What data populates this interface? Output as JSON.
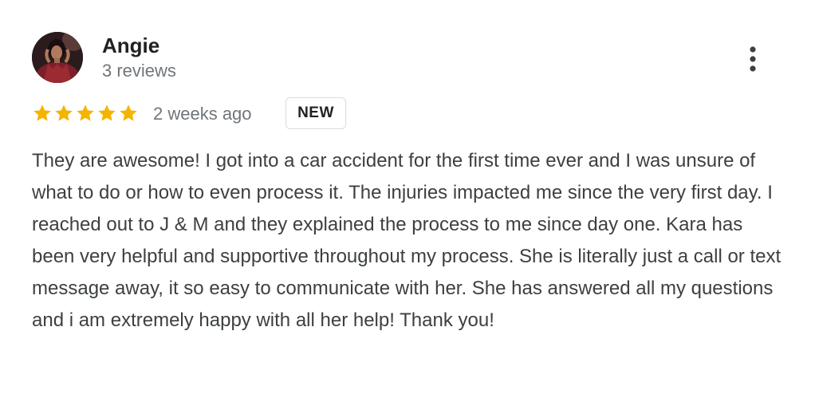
{
  "review": {
    "author": {
      "name": "Angie",
      "reviews_count": "3 reviews",
      "avatar_icon": "profile-photo-icon"
    },
    "rating": {
      "stars": 5,
      "max": 5,
      "color": "#f4b400"
    },
    "date": "2 weeks ago",
    "badge": "NEW",
    "text": "They are awesome! I got into a car accident for the first time ever and I was unsure of what to do or how to even process it. The injuries impacted me since the very first day. I reached out to J & M and they explained the process to me since day one. Kara has been very helpful and supportive throughout my process. She is literally just a call or text message away, it so easy to communicate with her. She has answered all my questions and i am extremely happy with all her help! Thank you!",
    "more_icon": "more-vert-icon"
  }
}
